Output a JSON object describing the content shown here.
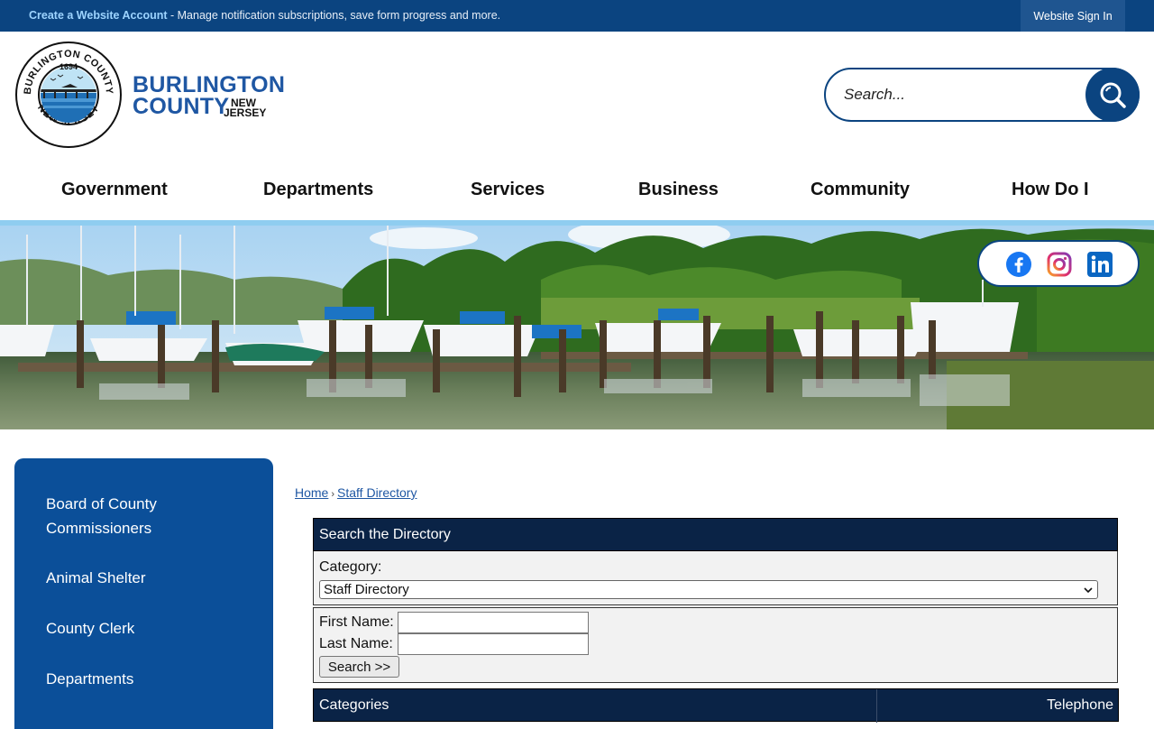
{
  "topbar": {
    "create_link": "Create a Website Account",
    "message": " - Manage notification subscriptions, save form progress and more.",
    "sign_in": "Website Sign In"
  },
  "logo": {
    "seal_top": "BURLINGTON COUNTY",
    "seal_bottom": "NEW JERSEY",
    "seal_year": "1694",
    "line1": "BURLINGTON",
    "line2": "COUNTY",
    "state1": "NEW",
    "state2": "JERSEY"
  },
  "search": {
    "placeholder": "Search..."
  },
  "nav": {
    "items": [
      {
        "label": "Government"
      },
      {
        "label": "Departments"
      },
      {
        "label": "Services"
      },
      {
        "label": "Business"
      },
      {
        "label": "Community"
      },
      {
        "label": "How Do I"
      }
    ]
  },
  "social": [
    "facebook-icon",
    "instagram-icon",
    "linkedin-icon"
  ],
  "sidebar": {
    "items": [
      {
        "label": "Board of County Commissioners"
      },
      {
        "label": "Animal Shelter"
      },
      {
        "label": "County Clerk"
      },
      {
        "label": "Departments"
      }
    ]
  },
  "breadcrumb": {
    "home": "Home",
    "sep": "›",
    "current": "Staff Directory"
  },
  "directory": {
    "heading": "Search the Directory",
    "category_label": "Category:",
    "category_value": "Staff Directory",
    "first_name_label": "First Name:",
    "last_name_label": "Last Name:",
    "search_button": "Search >>",
    "table_header": {
      "categories": "Categories",
      "telephone": "Telephone"
    }
  },
  "colors": {
    "brand_navy": "#0b4480",
    "sidebar_blue": "#0b4f99",
    "table_header": "#0a2346",
    "accent_light_blue": "#8fcdf0"
  }
}
